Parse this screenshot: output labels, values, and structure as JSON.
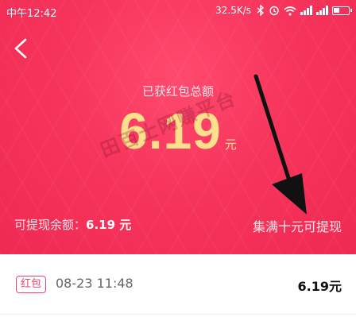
{
  "status_bar": {
    "time": "中午12:42",
    "speed": "32.5K/s",
    "icons": [
      "bluetooth-icon",
      "alarm-icon",
      "wifi-icon",
      "signal-icon",
      "signal-icon",
      "battery-icon"
    ]
  },
  "header": {
    "back_icon": "chevron-left-icon"
  },
  "summary": {
    "total_label": "已获红包总额",
    "total_amount": "6.19",
    "unit": "元",
    "withdrawable_label": "可提现余额：",
    "withdrawable_value": "6.19 元",
    "threshold_text": "集满十元可提现"
  },
  "watermark": "田百士网赚平台",
  "records": [
    {
      "tag": "红包",
      "time": "08-23 11:48",
      "amount": "6.19元"
    }
  ],
  "colors": {
    "hero_bg": "#f7345c",
    "amount_gold": "#ffe08a",
    "tag_red": "#f2426a"
  }
}
